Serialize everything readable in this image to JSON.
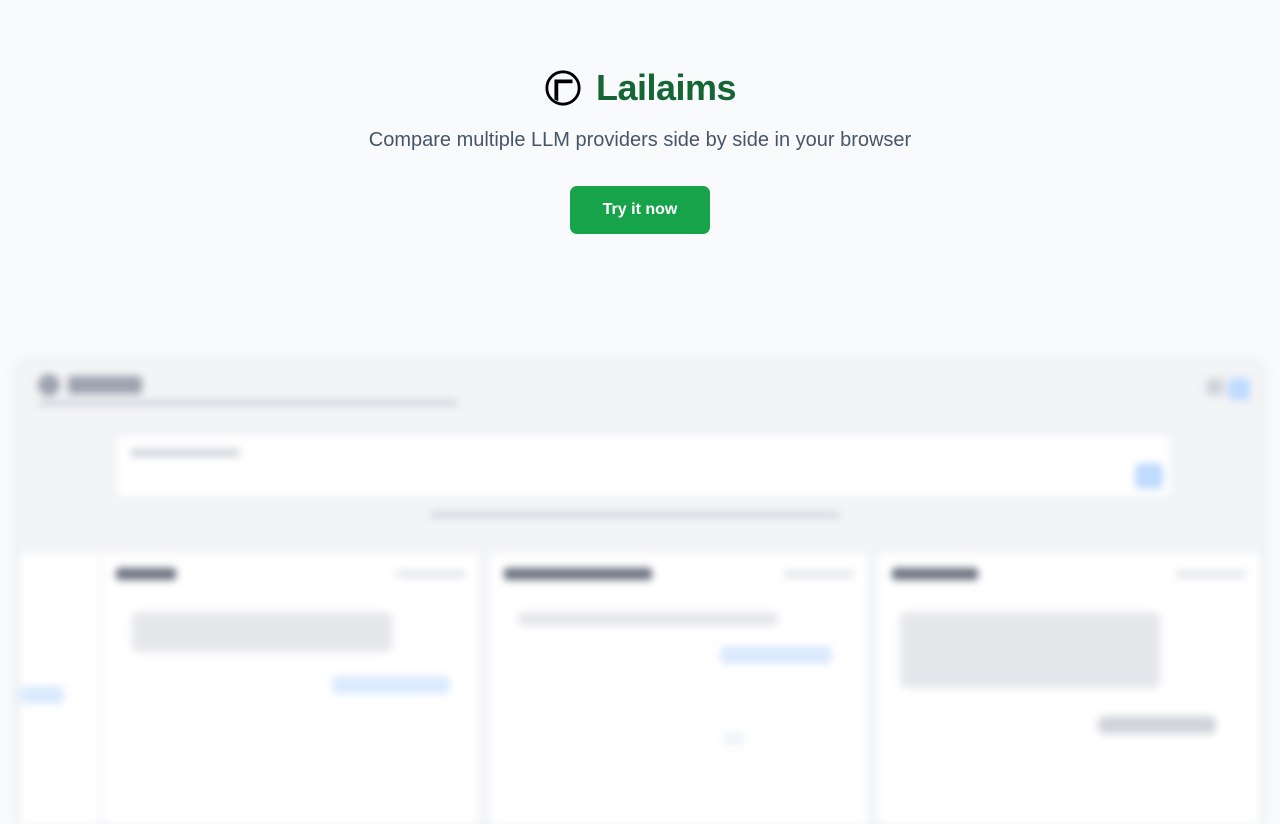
{
  "brand": {
    "name": "Lailaims",
    "logo_icon": "circle-window-icon",
    "color": "#166534"
  },
  "tagline": "Compare multiple LLM providers side by side in your browser",
  "cta": {
    "label": "Try it now",
    "color": "#16a34a"
  },
  "preview": {
    "description_visible": false
  }
}
